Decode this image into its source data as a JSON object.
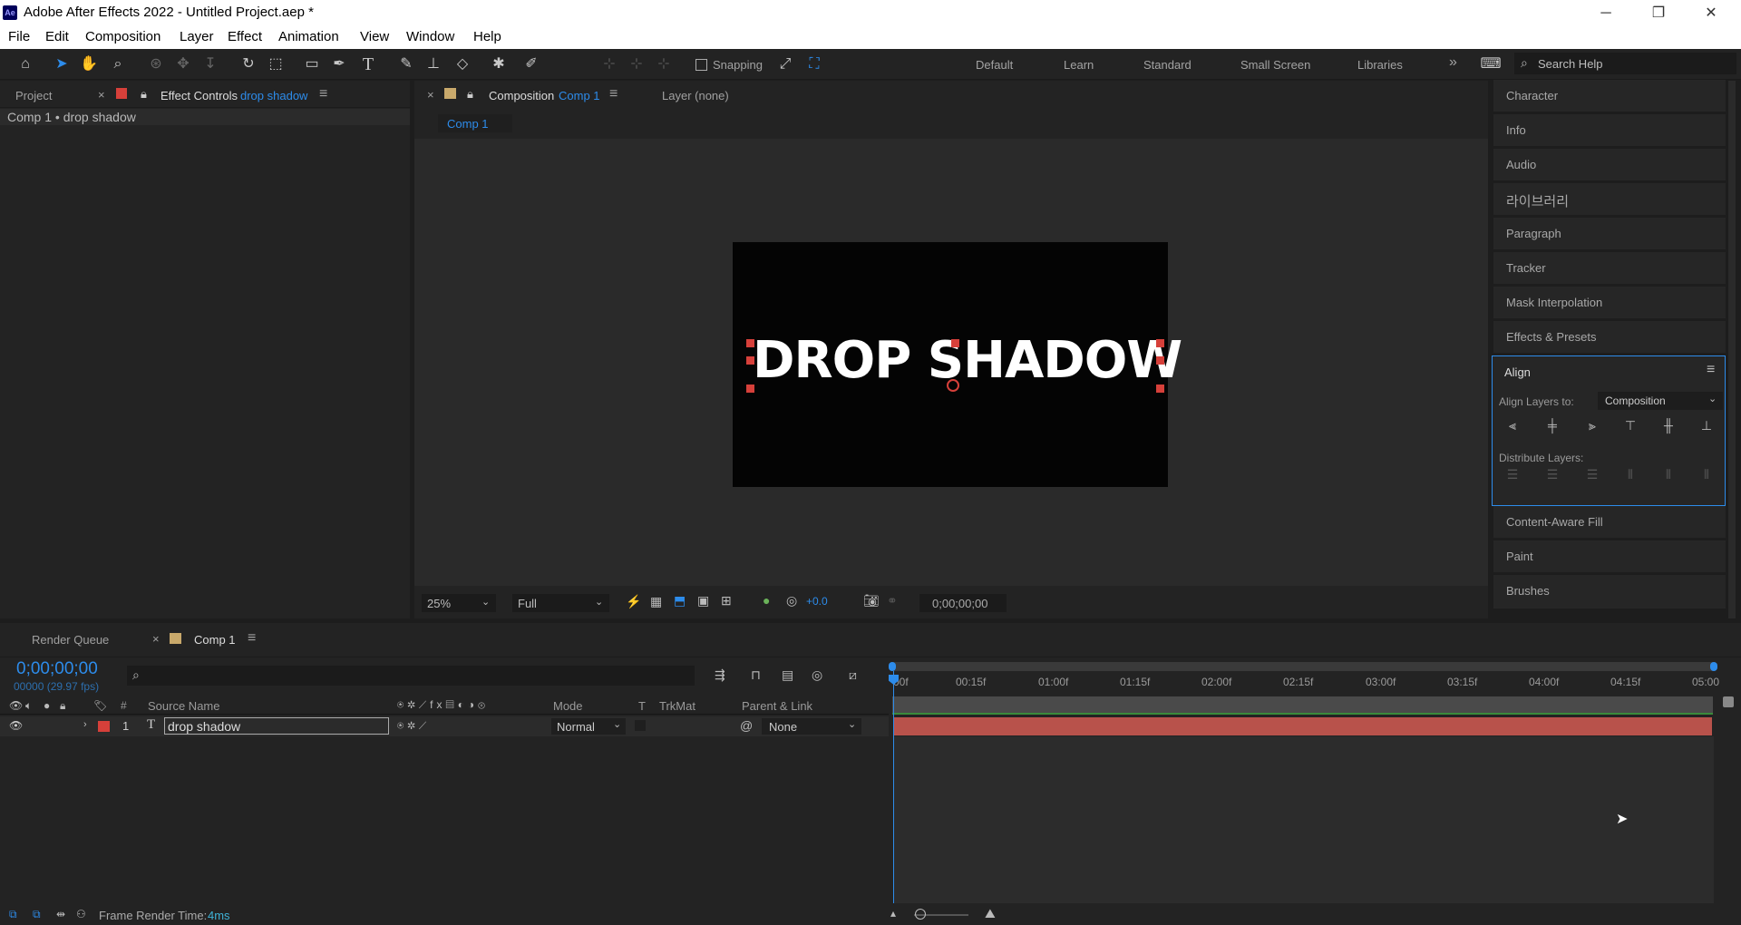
{
  "app": {
    "title": "Adobe After Effects 2022 - Untitled Project.aep *",
    "logo": "Ae"
  },
  "window_controls": {
    "minimize": "─",
    "restore": "❐",
    "close": "✕"
  },
  "menu": [
    "File",
    "Edit",
    "Composition",
    "Layer",
    "Effect",
    "Animation",
    "View",
    "Window",
    "Help"
  ],
  "toolbar": {
    "snapping_label": "Snapping",
    "workspaces": [
      "Default",
      "Learn",
      "Standard",
      "Small Screen",
      "Libraries"
    ],
    "more": "»",
    "search_placeholder": "Search Help"
  },
  "left_panel": {
    "tab_project": "Project",
    "tab_effect_controls": "Effect Controls",
    "tab_effect_controls_layer": "drop shadow",
    "close": "×",
    "breadcrumb": "Comp 1 • drop shadow"
  },
  "comp_panel": {
    "tab_composition": "Composition",
    "tab_comp_name": "Comp 1",
    "tab_layer": "Layer (none)",
    "subtab": "Comp 1",
    "close": "×",
    "canvas_text": "DROP SHADOW",
    "zoom": "25%",
    "resolution": "Full",
    "exposure": "+0.0",
    "timecode": "0;00;00;00"
  },
  "right_panel": {
    "items_top": [
      "Character",
      "Info",
      "Audio",
      "라이브러리",
      "Paragraph",
      "Tracker",
      "Mask Interpolation",
      "Effects & Presets"
    ],
    "align": {
      "title": "Align",
      "align_layers_to_label": "Align Layers to:",
      "align_layers_to_value": "Composition",
      "distribute_label": "Distribute Layers:"
    },
    "items_bottom": [
      "Content-Aware Fill",
      "Paint",
      "Brushes"
    ]
  },
  "timeline": {
    "tab_render_queue": "Render Queue",
    "tab_comp": "Comp 1",
    "close": "×",
    "timecode": "0;00;00;00",
    "fps": "00000 (29.97 fps)",
    "ruler": [
      "00f",
      "00:15f",
      "01:00f",
      "01:15f",
      "02:00f",
      "02:15f",
      "03:00f",
      "03:15f",
      "04:00f",
      "04:15f",
      "05:00"
    ],
    "columns": {
      "num": "#",
      "source": "Source Name",
      "mode": "Mode",
      "t": "T",
      "trkmat": "TrkMat",
      "parent": "Parent & Link"
    },
    "layer": {
      "index": "1",
      "type": "T",
      "name": "drop shadow",
      "mode": "Normal",
      "parent": "None",
      "label_color": "#d6403a"
    },
    "status_label": "Frame Render Time:",
    "status_value": "4ms"
  },
  "colors": {
    "accent": "#2d8ceb",
    "layer_bar": "#b8524b",
    "comp_tab_label": "#c9a96b"
  }
}
